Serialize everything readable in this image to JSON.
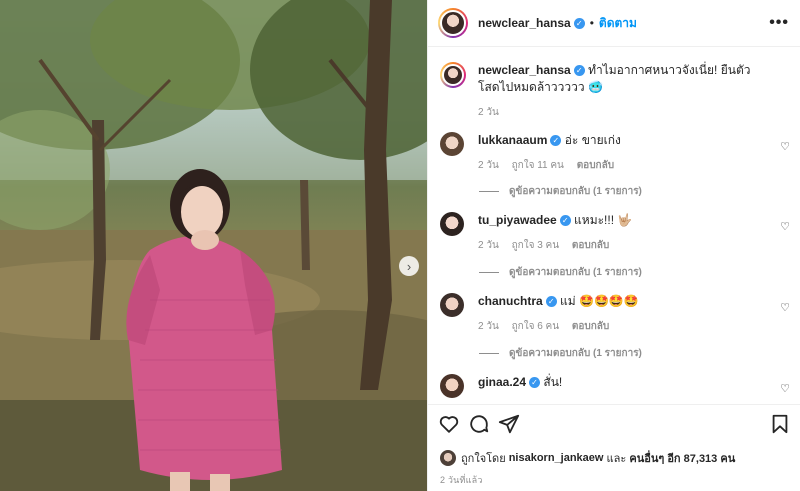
{
  "post": {
    "username": "newclear_hansa",
    "follow_label": "ติดตาม",
    "more_label": "•••",
    "next_label": "›"
  },
  "caption": {
    "username": "newclear_hansa",
    "text": "ทำไมอากาศหนาวจังเนี่ย! ยืนตัวโสดไปหมดล้าววววว 🥶",
    "time": "2 วัน"
  },
  "comments": [
    {
      "username": "lukkanaaum",
      "text": "อ่ะ ขายเก่ง",
      "time": "2 วัน",
      "likes": "ถูกใจ 11 คน",
      "reply": "ตอบกลับ",
      "view_replies": "ดูข้อความตอบกลับ (1 รายการ)"
    },
    {
      "username": "tu_piyawadee",
      "text": "แหมะ!!! 🤟🏼",
      "time": "2 วัน",
      "likes": "ถูกใจ 3 คน",
      "reply": "ตอบกลับ",
      "view_replies": "ดูข้อความตอบกลับ (1 รายการ)"
    },
    {
      "username": "chanuchtra",
      "text": "แม่ 🤩🤩🤩🤩",
      "time": "2 วัน",
      "likes": "ถูกใจ 6 คน",
      "reply": "ตอบกลับ",
      "view_replies": "ดูข้อความตอบกลับ (1 รายการ)"
    },
    {
      "username": "ginaa.24",
      "text": "สั่น!"
    }
  ],
  "likes_line": {
    "prefix": "ถูกใจโดย",
    "user": "nisakorn_jankaew",
    "middle": "และ",
    "others": "คนอื่นๆ อีก 87,313 คน"
  },
  "timestamp": "2 วันที่แล้ว",
  "icons": {
    "verified": "✓",
    "heart": "♡"
  }
}
